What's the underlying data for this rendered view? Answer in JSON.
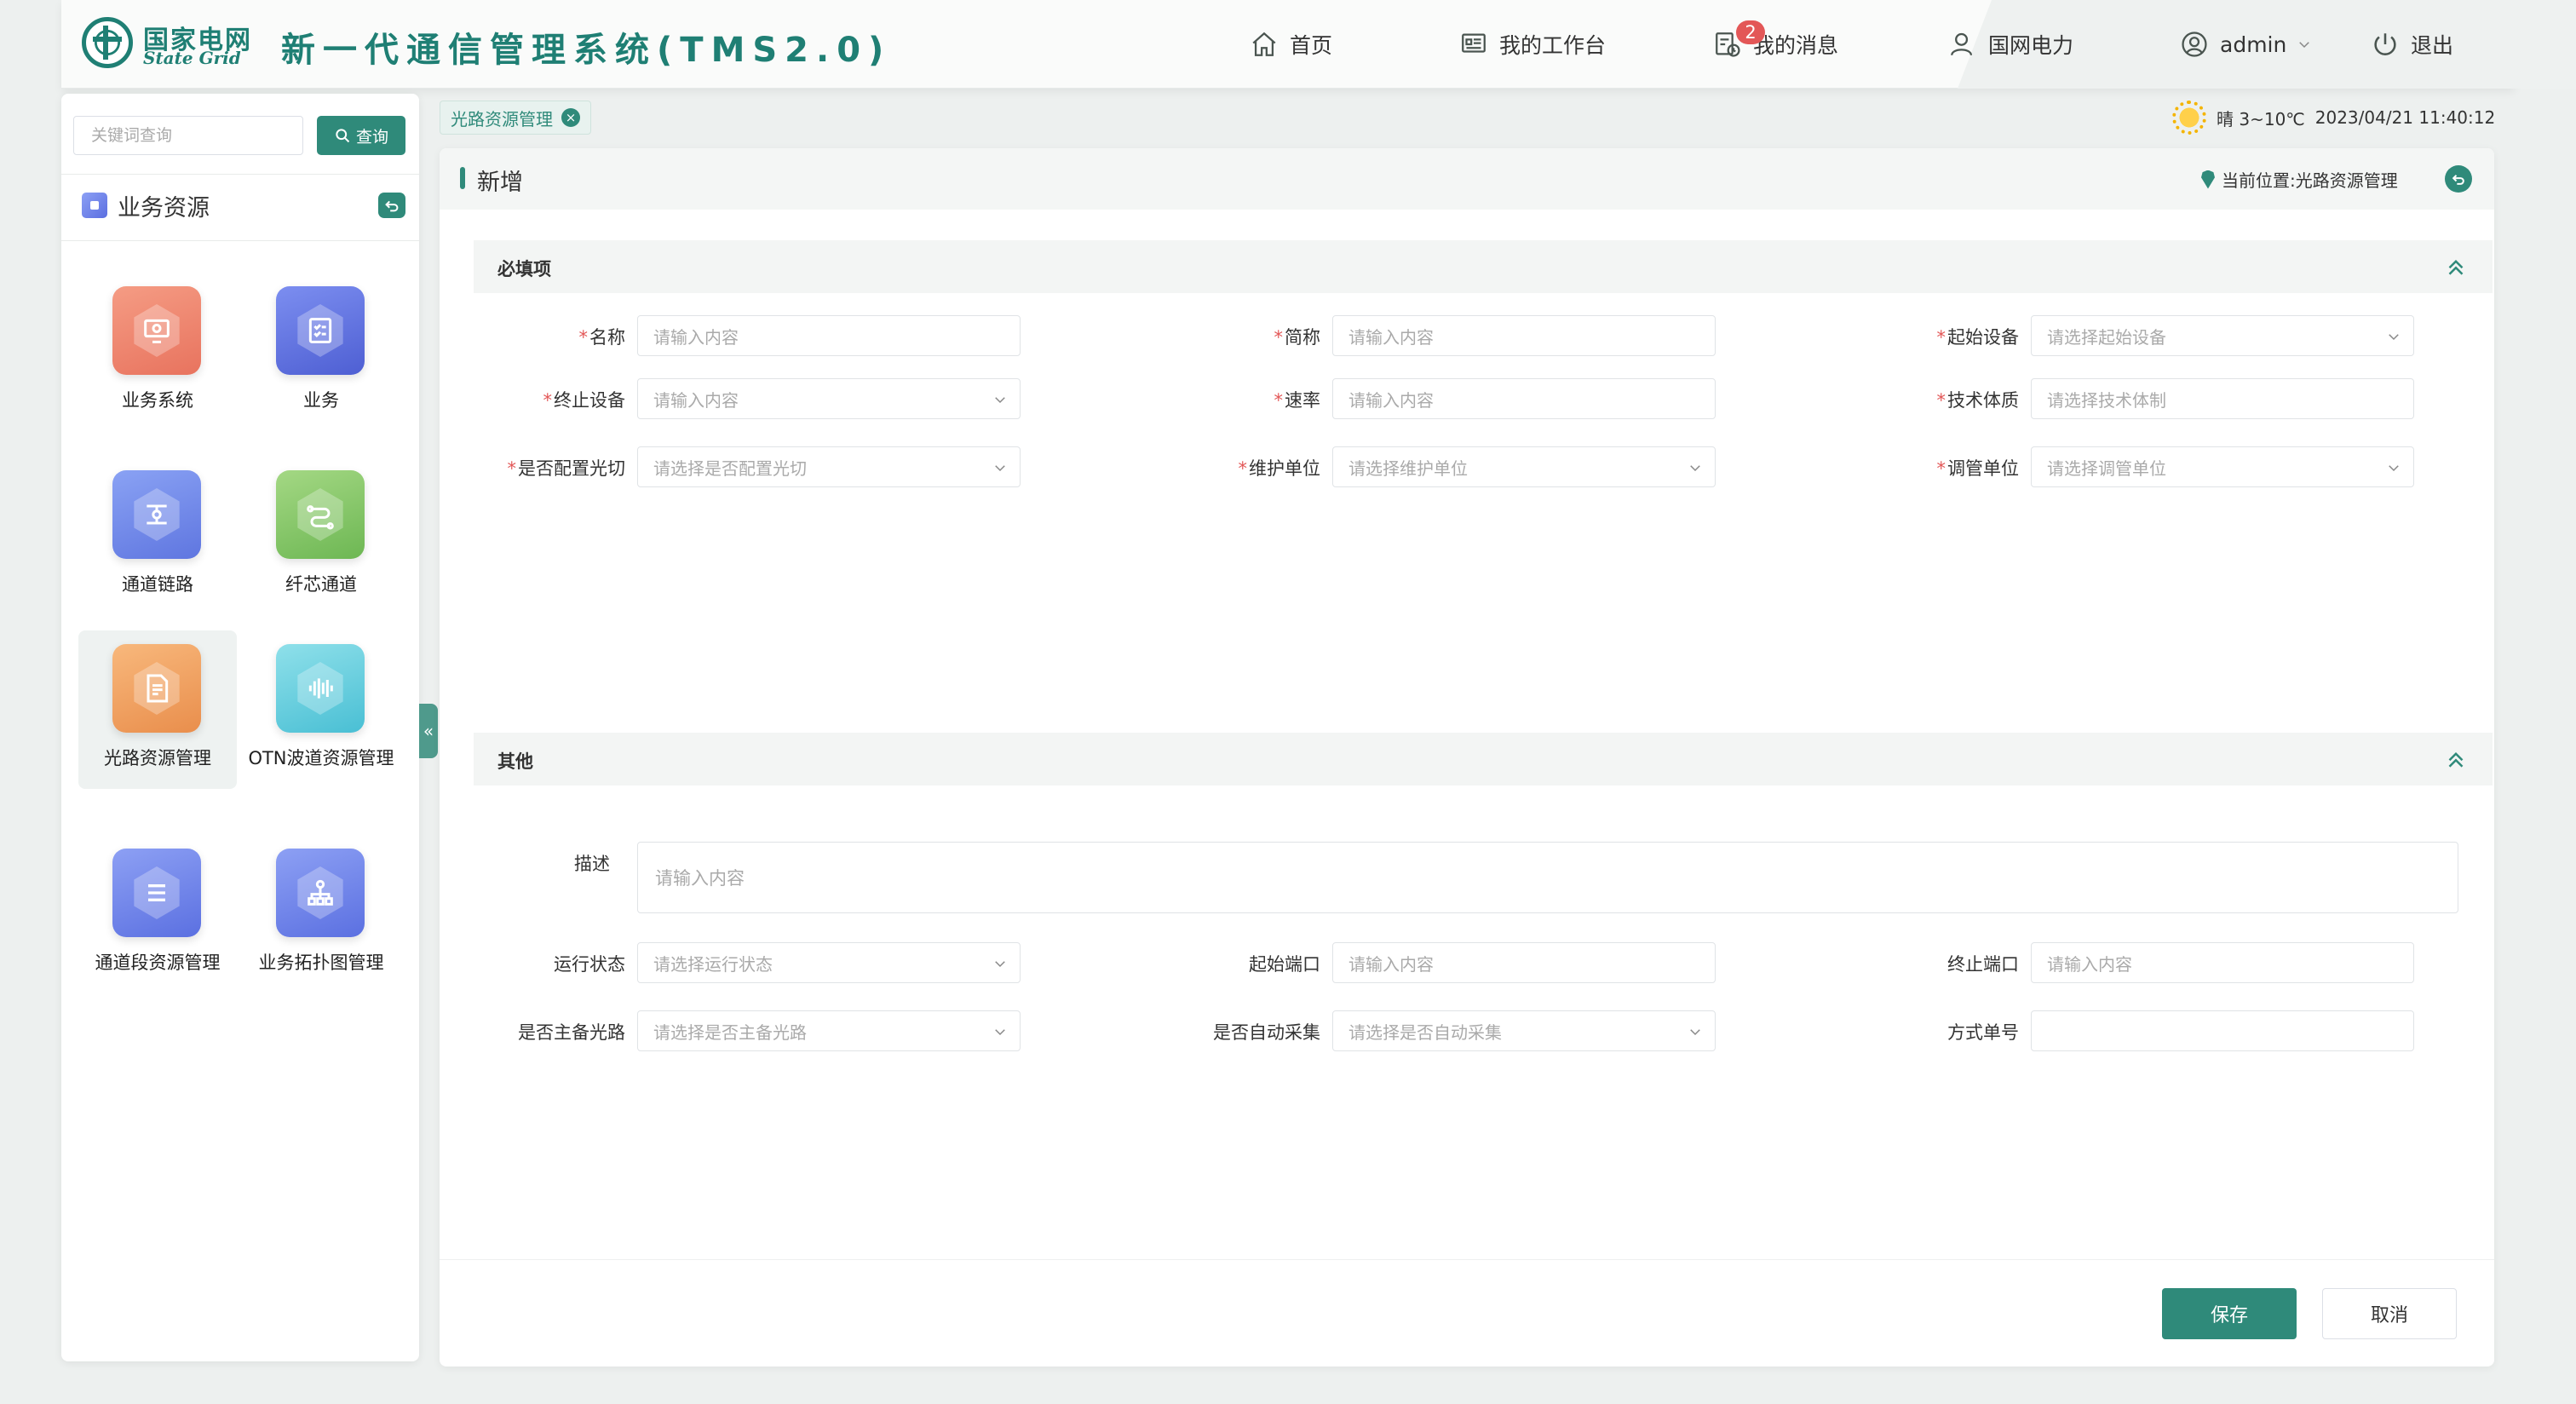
{
  "header": {
    "logo_cn": "国家电网",
    "logo_en": "State Grid",
    "app_title": "新一代通信管理系统(TMS2.0)",
    "nav": {
      "home": "首页",
      "workbench": "我的工作台",
      "messages": "我的消息",
      "messages_badge": "2",
      "org": "国网电力",
      "user": "admin",
      "logout": "退出"
    }
  },
  "sidebar": {
    "search_placeholder": "关键词查询",
    "search_button": "查询",
    "title": "业务资源",
    "items": [
      {
        "label": "业务系统",
        "icon": "monitor-icon",
        "color_from": "#f59c84",
        "color_to": "#e8735e"
      },
      {
        "label": "业务",
        "icon": "checklist-icon",
        "color_from": "#7c8ef0",
        "color_to": "#4e5fd3"
      },
      {
        "label": "通道链路",
        "icon": "link-icon",
        "color_from": "#8aa2f4",
        "color_to": "#5f76e0"
      },
      {
        "label": "纤芯通道",
        "icon": "fiber-icon",
        "color_from": "#a4d884",
        "color_to": "#6db753"
      },
      {
        "label": "光路资源管理",
        "icon": "document-icon",
        "color_from": "#f8b87c",
        "color_to": "#e98e4c"
      },
      {
        "label": "OTN波道资源管理",
        "icon": "wave-icon",
        "color_from": "#8fe0ea",
        "color_to": "#49bfd4"
      },
      {
        "label": "通道段资源管理",
        "icon": "list-icon",
        "color_from": "#8da0f4",
        "color_to": "#5b70e1"
      },
      {
        "label": "业务拓扑图管理",
        "icon": "topology-icon",
        "color_from": "#8da0f4",
        "color_to": "#5b70e1"
      }
    ],
    "active_index": 4
  },
  "tabs": [
    {
      "label": "光路资源管理"
    }
  ],
  "weather": {
    "text": "晴 3~10℃",
    "datetime": "2023/04/21 11:40:12"
  },
  "panel": {
    "title": "新增",
    "location": "当前位置:光路资源管理"
  },
  "required_section": {
    "title": "必填项",
    "fields": [
      {
        "label": "名称",
        "placeholder": "请输入内容",
        "type": "input",
        "required": true
      },
      {
        "label": "简称",
        "placeholder": "请输入内容",
        "type": "input",
        "required": true
      },
      {
        "label": "起始设备",
        "placeholder": "请选择起始设备",
        "type": "select",
        "required": true
      },
      {
        "label": "终止设备",
        "placeholder": "请输入内容",
        "type": "select",
        "required": true
      },
      {
        "label": "速率",
        "placeholder": "请输入内容",
        "type": "input",
        "required": true
      },
      {
        "label": "技术体质",
        "placeholder": "请选择技术体制",
        "type": "input",
        "required": true
      },
      {
        "label": "是否配置光切",
        "placeholder": "请选择是否配置光切",
        "type": "select",
        "required": true
      },
      {
        "label": "维护单位",
        "placeholder": "请选择维护单位",
        "type": "select",
        "required": true
      },
      {
        "label": "调管单位",
        "placeholder": "请选择调管单位",
        "type": "select",
        "required": true
      }
    ]
  },
  "other_section": {
    "title": "其他",
    "description": {
      "label": "描述",
      "placeholder": "请输入内容"
    },
    "fields": [
      {
        "label": "运行状态",
        "placeholder": "请选择运行状态",
        "type": "select"
      },
      {
        "label": "起始端口",
        "placeholder": "请输入内容",
        "type": "input"
      },
      {
        "label": "终止端口",
        "placeholder": "请输入内容",
        "type": "input"
      },
      {
        "label": "是否主备光路",
        "placeholder": "请选择是否主备光路",
        "type": "select"
      },
      {
        "label": "是否自动采集",
        "placeholder": "请选择是否自动采集",
        "type": "select"
      },
      {
        "label": "方式单号",
        "placeholder": "",
        "type": "input"
      }
    ]
  },
  "actions": {
    "save": "保存",
    "cancel": "取消"
  },
  "colors": {
    "accent": "#2f8a7a",
    "required": "#e35757"
  }
}
